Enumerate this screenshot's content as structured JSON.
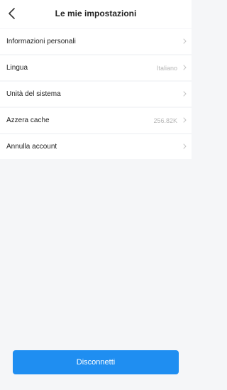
{
  "header": {
    "title": "Le mie impostazioni",
    "back_icon": "chevron-left-icon"
  },
  "menu": {
    "items": [
      {
        "label": "Informazioni personali",
        "value": ""
      },
      {
        "label": "Lingua",
        "value": "Italiano"
      },
      {
        "label": "Unità del sistema",
        "value": ""
      },
      {
        "label": "Azzera cache",
        "value": "256.82K"
      },
      {
        "label": "Annulla account",
        "value": ""
      }
    ],
    "chevron_icon": "chevron-right-icon"
  },
  "footer": {
    "logout_label": "Disconnetti"
  },
  "colors": {
    "accent": "#1f8ef1",
    "background": "#f5f6f8",
    "text": "#222222",
    "muted": "#b7b7b7"
  }
}
